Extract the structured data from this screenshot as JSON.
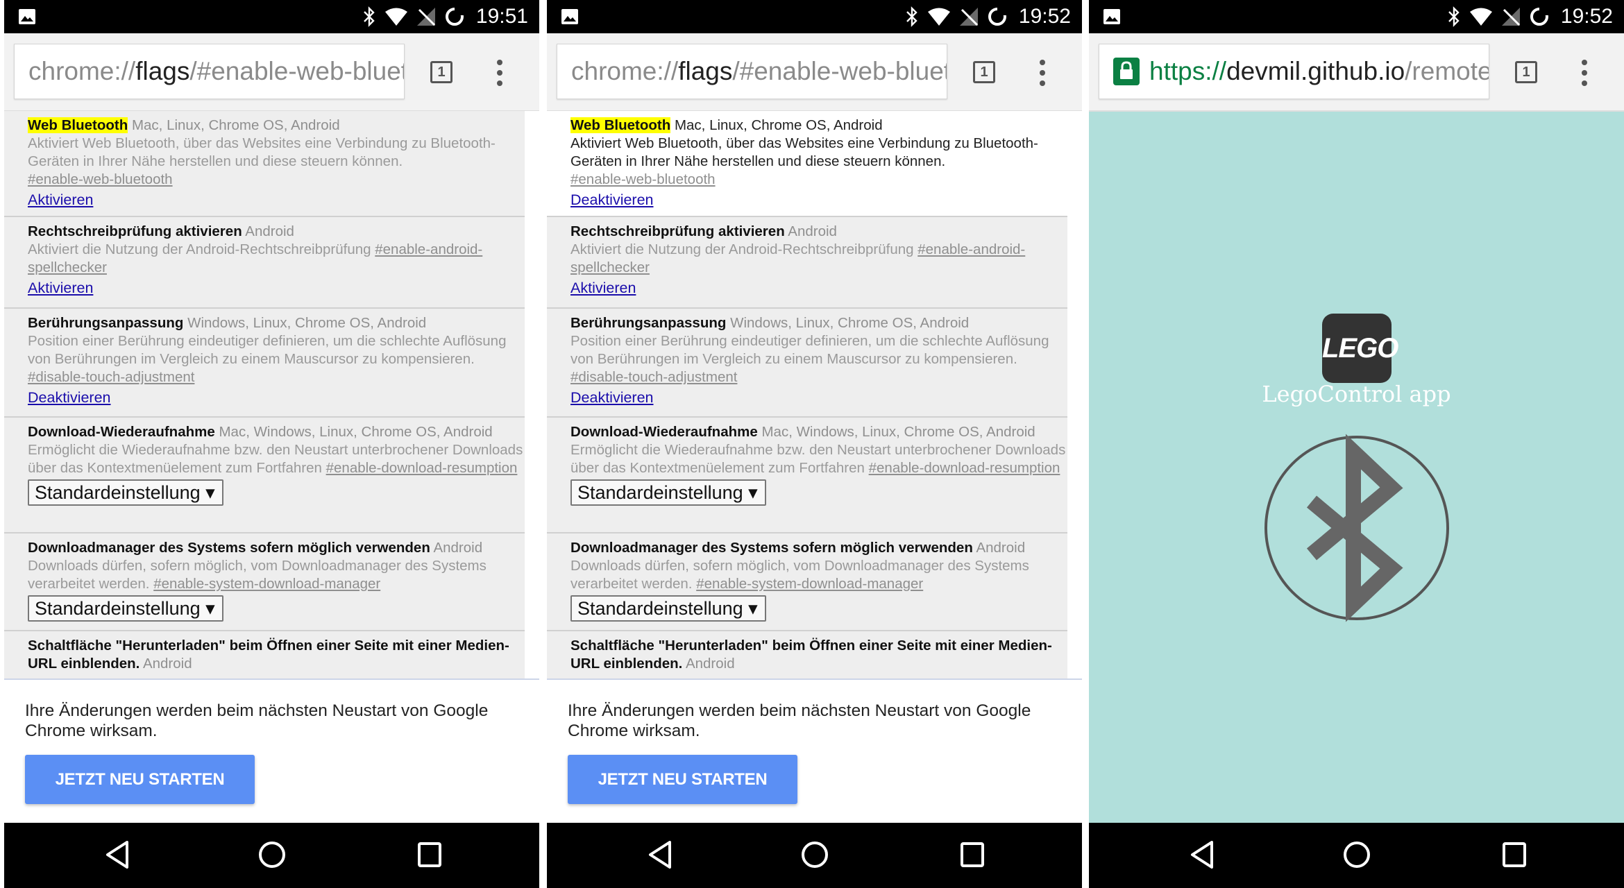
{
  "status_bar": {
    "times": [
      "19:51",
      "19:52",
      "19:52"
    ]
  },
  "screens": [
    {
      "url": {
        "scheme": "chrome://",
        "host": "flags",
        "path": "/#enable-web-blueto"
      },
      "tab_count": "1",
      "flags": [
        {
          "name": "Web Bluetooth",
          "platforms": "Mac, Linux, Chrome OS, Android",
          "description": "Aktiviert Web Bluetooth, über das Websites eine Verbindung zu Bluetooth-Geräten in Ihrer Nähe herstellen und diese steuern können.",
          "link": "#enable-web-bluetooth",
          "action": "Aktivieren"
        },
        {
          "name": "Rechtschreibprüfung aktivieren",
          "platforms": "Android",
          "description": "Aktiviert die Nutzung der Android-Rechtschreibprüfung",
          "link": "#enable-android-spellchecker",
          "action": "Aktivieren"
        },
        {
          "name": "Berührungsanpassung",
          "platforms": "Windows, Linux, Chrome OS, Android",
          "description": "Position einer Berührung eindeutiger definieren, um die schlechte Auflösung von Berührungen im Vergleich zu einem Mauscursor zu kompensieren.",
          "link": "#disable-touch-adjustment",
          "action": "Deaktivieren"
        },
        {
          "name": "Download-Wiederaufnahme",
          "platforms": "Mac, Windows, Linux, Chrome OS, Android",
          "description": "Ermöglicht die Wiederaufnahme bzw. den Neustart unterbrochener Downloads über das Kontextmenüelement zum Fortfahren",
          "link": "#enable-download-resumption",
          "select": "Standardeinstellung ▾"
        },
        {
          "name": "Downloadmanager des Systems sofern möglich verwenden",
          "platforms": "Android",
          "description": "Downloads dürfen, sofern möglich, vom Downloadmanager des Systems verarbeitet werden.",
          "link": "#enable-system-download-manager",
          "select": "Standardeinstellung ▾"
        },
        {
          "name": "Schaltfläche \"Herunterladen\" beim Öffnen einer Seite mit einer Medien-URL einblenden.",
          "platforms": "Android"
        }
      ],
      "notice": "Ihre Änderungen werden beim nächsten Neustart von Google Chrome wirksam.",
      "restart_button": "JETZT NEU STARTEN"
    },
    {
      "url": {
        "scheme": "chrome://",
        "host": "flags",
        "path": "/#enable-web-blueto"
      },
      "tab_count": "1",
      "flags": [
        {
          "name": "Web Bluetooth",
          "platforms": "Mac, Linux, Chrome OS, Android",
          "description": "Aktiviert Web Bluetooth, über das Websites eine Verbindung zu Bluetooth-Geräten in Ihrer Nähe herstellen und diese steuern können.",
          "link": "#enable-web-bluetooth",
          "action": "Deaktivieren"
        },
        {
          "name": "Rechtschreibprüfung aktivieren",
          "platforms": "Android",
          "description": "Aktiviert die Nutzung der Android-Rechtschreibprüfung",
          "link": "#enable-android-spellchecker",
          "action": "Aktivieren"
        },
        {
          "name": "Berührungsanpassung",
          "platforms": "Windows, Linux, Chrome OS, Android",
          "description": "Position einer Berührung eindeutiger definieren, um die schlechte Auflösung von Berührungen im Vergleich zu einem Mauscursor zu kompensieren.",
          "link": "#disable-touch-adjustment",
          "action": "Deaktivieren"
        },
        {
          "name": "Download-Wiederaufnahme",
          "platforms": "Mac, Windows, Linux, Chrome OS, Android",
          "description": "Ermöglicht die Wiederaufnahme bzw. den Neustart unterbrochener Downloads über das Kontextmenüelement zum Fortfahren",
          "link": "#enable-download-resumption",
          "select": "Standardeinstellung ▾"
        },
        {
          "name": "Downloadmanager des Systems sofern möglich verwenden",
          "platforms": "Android",
          "description": "Downloads dürfen, sofern möglich, vom Downloadmanager des Systems verarbeitet werden.",
          "link": "#enable-system-download-manager",
          "select": "Standardeinstellung ▾"
        },
        {
          "name": "Schaltfläche \"Herunterladen\" beim Öffnen einer Seite mit einer Medien-URL einblenden.",
          "platforms": "Android"
        }
      ],
      "notice": "Ihre Änderungen werden beim nächsten Neustart von Google Chrome wirksam.",
      "restart_button": "JETZT NEU STARTEN"
    },
    {
      "url": {
        "scheme": "https://",
        "host": "devmil.github.io",
        "path": "/remote"
      },
      "tab_count": "1",
      "app_logo": "LEGO",
      "app_title": "LegoControl app"
    }
  ],
  "colors": {
    "accent_button": "#5b8ff4",
    "highlight": "#ffff00",
    "lego_bg": "#b1dfdb",
    "secure_green": "#0b8043"
  }
}
